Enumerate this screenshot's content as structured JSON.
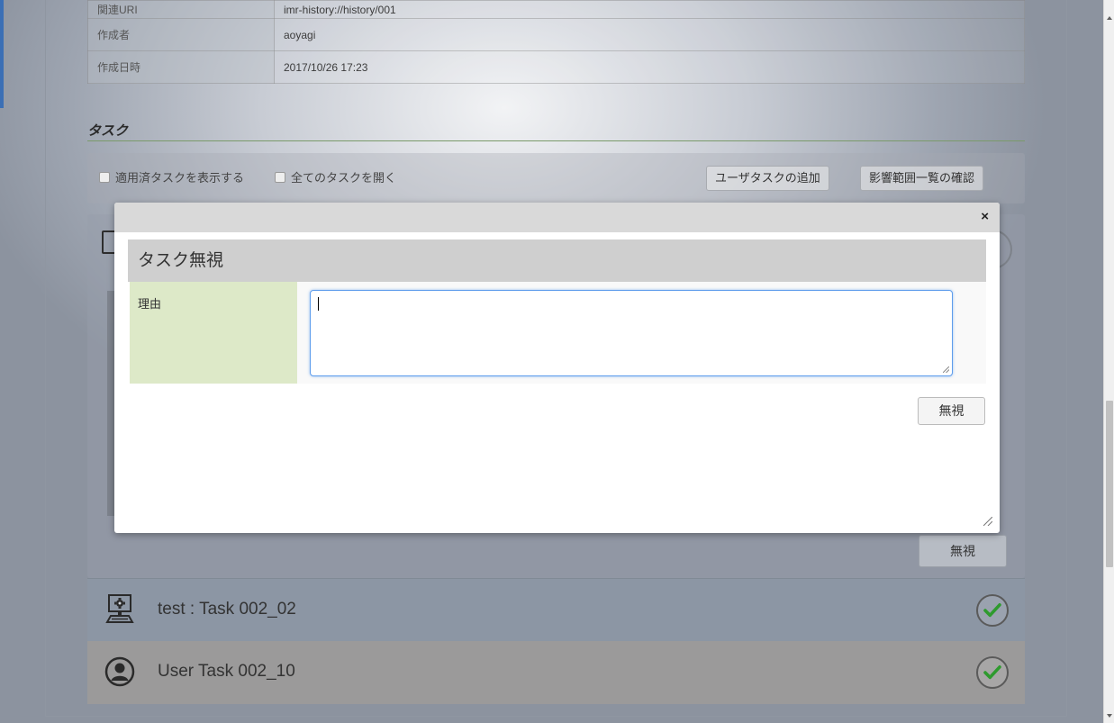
{
  "info_rows": [
    {
      "key": "関連URI",
      "value": "imr-history://history/001"
    },
    {
      "key": "作成者",
      "value": "aoyagi"
    },
    {
      "key": "作成日時",
      "value": "2017/10/26 17:23"
    }
  ],
  "section": {
    "title": "タスク"
  },
  "toolbar": {
    "show_applied_label": "適用済タスクを表示する",
    "open_all_label": "全てのタスクを開く",
    "add_user_task_label": "ユーザタスクの追加",
    "confirm_impact_label": "影響範囲一覧の確認"
  },
  "panel": {
    "ignore_label": "無視"
  },
  "tasks": [
    {
      "label": "test : Task 002_02",
      "icon": "computer-gear-icon",
      "status": "checked"
    },
    {
      "label": "User Task 002_10",
      "icon": "user-icon",
      "status": "checked"
    }
  ],
  "modal": {
    "close_glyph": "×",
    "title": "タスク無視",
    "reason_label": "理由",
    "reason_value": "",
    "ignore_button_label": "無視"
  },
  "colors": {
    "modal_header_bg": "#cfcfcf",
    "label_cell_bg": "#dde9c8",
    "focus_border": "#5d9cec",
    "check_green": "#2e9a2e"
  }
}
